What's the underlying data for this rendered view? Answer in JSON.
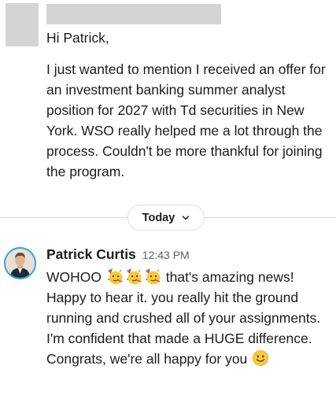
{
  "first_message": {
    "greeting": "Hi Patrick,",
    "body": "I just wanted to mention I received an offer for an investment banking summer analyst position for 2027 with Td securities in New York. WSO really helped me a lot through the process. Couldn't be more thankful for joining the program."
  },
  "day_divider": {
    "label": "Today",
    "icon": "chevron-down-icon"
  },
  "second_message": {
    "sender": "Patrick Curtis",
    "timestamp": "12:43 PM",
    "lead": "WOHOO",
    "after_emoji": " that's amazing news! Happy to hear it. you really hit the ground running and crushed all of your assignments. I'm confident that made a HUGE difference. Congrats, we're all happy for you ",
    "emojis": [
      "partying-face-emoji",
      "partying-face-emoji",
      "partying-face-emoji",
      "slightly-smiling-face-emoji"
    ]
  },
  "colors": {
    "text": "#1d1c1d",
    "muted": "#616061",
    "divider": "#dddddd",
    "avatar_ring": "#2ea3d9",
    "redaction": "#d4d4d4"
  }
}
